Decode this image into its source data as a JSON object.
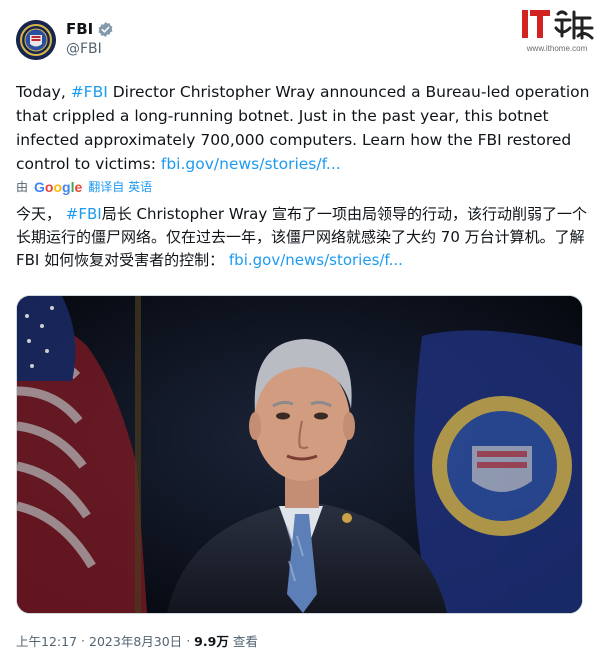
{
  "account": {
    "name": "FBI",
    "handle": "@FBI",
    "verified_icon": "verified-badge-icon",
    "avatar_icon": "fbi-seal-icon"
  },
  "watermark": {
    "logo_text": "IT之家",
    "url": "www.ithome.com"
  },
  "tweet": {
    "text_before": "Today, ",
    "hashtag": "#FBI",
    "text_after": " Director Christopher Wray announced a Bureau-led operation that crippled a long-running botnet. Just in the past year, this botnet infected approximately 700,000 computers. Learn how the FBI restored control to victims: ",
    "link": "fbi.gov/news/stories/f..."
  },
  "translation": {
    "by_label": "由",
    "provider": "Google",
    "from_label": "翻译自 英语",
    "text_before": "今天， ",
    "hashtag": "#FBI",
    "text_after": "局长 Christopher Wray 宣布了一项由局领导的行动，该行动削弱了一个长期运行的僵尸网络。仅在过去一年，该僵尸网络就感染了大约 70 万台计算机。了解 FBI 如何恢复对受害者的控制： ",
    "link": "fbi.gov/news/stories/f..."
  },
  "media": {
    "description_icon": "video-thumbnail-icon"
  },
  "meta": {
    "time": "上午12:17",
    "separator": "·",
    "date": "2023年8月30日",
    "separator2": "·",
    "views_count": "9.9万",
    "views_label": "查看"
  },
  "colors": {
    "accent": "#1d9bf0",
    "secondary_text": "#536471",
    "primary_text": "#0f1419",
    "watermark_red": "#d22222"
  }
}
